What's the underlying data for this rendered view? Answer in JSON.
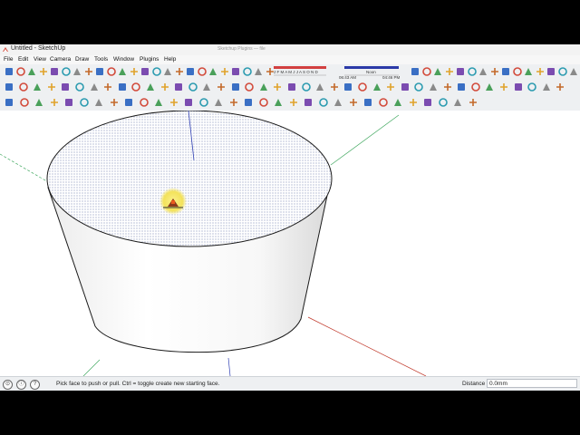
{
  "window": {
    "title": "Untitled - SketchUp",
    "background_title": "Sketchup Plugins — file"
  },
  "menu": [
    "File",
    "Edit",
    "View",
    "Camera",
    "Draw",
    "Tools",
    "Window",
    "Plugins",
    "Help"
  ],
  "shadow_settings": {
    "months": [
      "J",
      "F",
      "M",
      "A",
      "M",
      "J",
      "J",
      "A",
      "S",
      "O",
      "N",
      "D"
    ],
    "time_start": "06:43 AM",
    "noon_label": "Noon",
    "time_end": "04:46 PM"
  },
  "toolbar_icons": {
    "row1": [
      "select-tool-icon",
      "make-component-icon",
      "paint-bucket-icon",
      "eraser-icon",
      "rectangle-icon",
      "line-icon",
      "circle-icon",
      "arc-icon",
      "polygon-icon",
      "freehand-icon",
      "move-icon",
      "push-pull-icon",
      "rotate-icon",
      "follow-me-icon",
      "scale-icon",
      "offset-icon",
      "tape-measure-icon",
      "dimension-icon",
      "protractor-icon",
      "text-icon",
      "axes-icon",
      "3d-text-icon",
      "orbit-icon",
      "pan-icon",
      "zoom-icon",
      "zoom-window-icon",
      "zoom-extents-icon",
      "previous-view-icon",
      "next-view-icon",
      "position-camera-icon",
      "look-around-icon",
      "walk-icon",
      "section-plane-icon",
      "get-models-icon",
      "share-model-icon",
      "share-component-icon",
      "google-earth-icon",
      "photo-match-icon",
      "sandbox-icon",
      "layers-icon"
    ],
    "row2": [
      "iso-view-icon",
      "top-view-icon",
      "front-view-icon",
      "right-view-icon",
      "back-view-icon",
      "left-view-icon",
      "xray-icon",
      "back-edges-icon",
      "wireframe-icon",
      "hidden-line-icon",
      "shaded-icon",
      "shaded-textures-icon",
      "monochrome-icon",
      "display-shadows-icon",
      "fog-icon",
      "edge-styles-icon",
      "profiles-icon",
      "depth-cue-icon",
      "extension-icon",
      "union-icon",
      "intersect-icon",
      "subtract-icon",
      "trim-icon",
      "split-icon",
      "outer-shell-icon",
      "smoove-icon",
      "stamp-icon",
      "drape-icon",
      "add-detail-icon",
      "flip-edge-icon",
      "model-info-icon",
      "styles-icon",
      "materials-icon",
      "components-icon",
      "scenes-icon",
      "shadows-icon",
      "soften-icon",
      "outliner-icon",
      "entity-info-icon",
      "instructor-icon"
    ],
    "row3": [
      "select-arrow-icon",
      "lasso-icon",
      "paint-icon",
      "eraser-small-icon",
      "rect-small-icon",
      "line-small-icon",
      "circle-small-icon",
      "arc-small-icon",
      "poly-small-icon",
      "pushpull-small-icon",
      "followme-small-icon",
      "offset-small-icon",
      "move-small-icon",
      "rotate-small-icon",
      "scale-small-icon",
      "tape-small-icon",
      "dim-small-icon",
      "text-small-icon",
      "orbit-small-icon",
      "pan-small-icon",
      "zoom-small-icon",
      "zoomext-small-icon",
      "walk-small-icon",
      "look-small-icon",
      "section-small-icon",
      "plugin-a-icon",
      "plugin-b-icon",
      "plugin-c-icon",
      "plugin-d-icon",
      "plugin-e-icon",
      "plugin-f-icon",
      "plugin-g-icon"
    ]
  },
  "status": {
    "message": "Pick face to push or pull.  Ctrl = toggle create new starting face.",
    "measure_label": "Distance",
    "measure_value": "0.0mm"
  },
  "colors": {
    "background": "#ffffff",
    "cylinder_side": "#ffffff",
    "cylinder_edge": "#1a1a1a",
    "selected_face": "#9aa3c6",
    "axis_red": "#c0392b",
    "axis_green": "#41a860",
    "axis_blue": "#3141b4",
    "cursor_halo": "#f3e25a"
  }
}
